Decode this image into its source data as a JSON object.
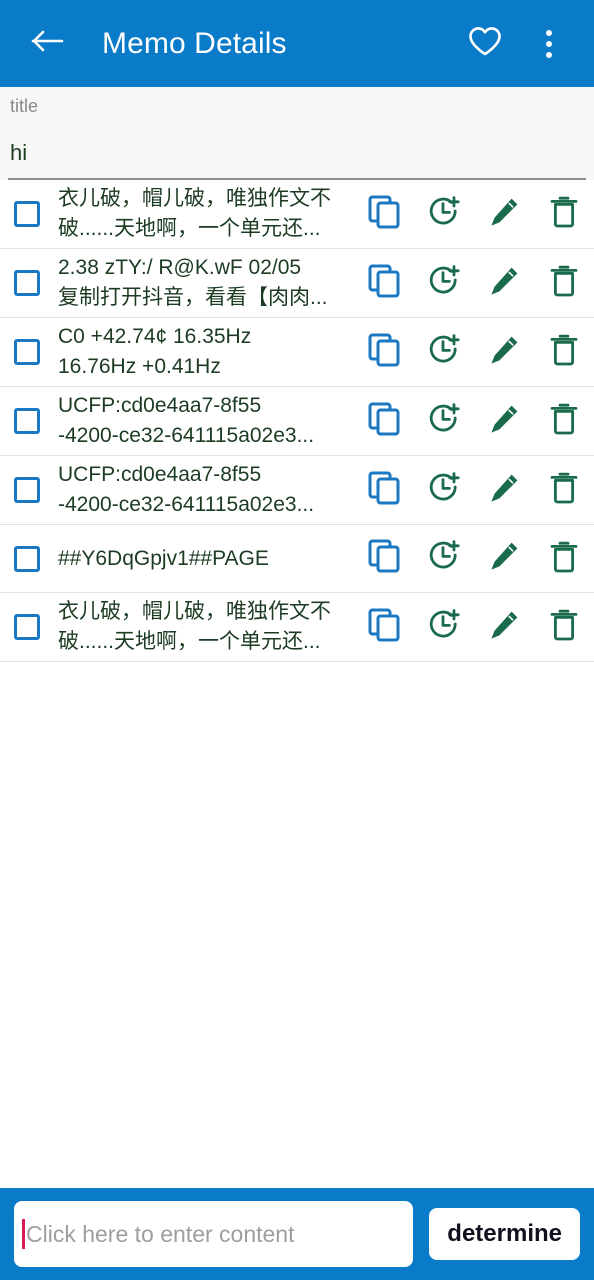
{
  "header": {
    "back_icon": "arrow-left-icon",
    "title": "Memo Details",
    "favorite_icon": "heart-icon",
    "overflow_icon": "more-vertical-icon",
    "background_color": "#0A7BC8"
  },
  "title_section": {
    "label": "title",
    "value": "hi"
  },
  "colors": {
    "accent_blue": "#0A7BC8",
    "checkbox_blue": "#1B79C4",
    "copy_blue": "#1B79C4",
    "action_green": "#1A6B4C",
    "text_dark": "#1C3B22",
    "caret_red": "#D81B52"
  },
  "list": {
    "row_icons": {
      "checkbox": "checkbox-unchecked-icon",
      "copy": "copy-icon",
      "alarm": "alarm-add-icon",
      "edit": "pencil-icon",
      "delete": "trash-icon"
    },
    "rows": [
      {
        "line1": "衣儿破，帽儿破，唯独作文不",
        "line2": "破......天地啊，一个单元还..."
      },
      {
        "line1": "2.38 zTY:/ R@K.wF 02/05",
        "line2": "复制打开抖音，看看【肉肉..."
      },
      {
        "line1": "C0 +42.74¢ 16.35Hz",
        "line2": "16.76Hz +0.41Hz"
      },
      {
        "line1": "UCFP:cd0e4aa7-8f55",
        "line2": "-4200-ce32-641115a02e3..."
      },
      {
        "line1": "UCFP:cd0e4aa7-8f55",
        "line2": "-4200-ce32-641115a02e3..."
      },
      {
        "line1": "##Y6DqGpjv1##PAGE",
        "line2": ""
      },
      {
        "line1": "衣儿破，帽儿破，唯独作文不",
        "line2": "破......天地啊，一个单元还..."
      }
    ]
  },
  "bottom_bar": {
    "input_placeholder": "Click here to enter content",
    "input_value": "",
    "confirm_label": "determine"
  }
}
